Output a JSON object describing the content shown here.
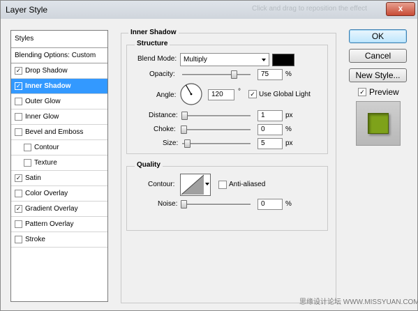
{
  "window": {
    "title": "Layer Style",
    "faded_text": "Click and drag to reposition the effect",
    "close_glyph": "x"
  },
  "styles_panel": {
    "header": "Styles",
    "blending": "Blending Options: Custom",
    "items": [
      {
        "label": "Drop Shadow",
        "checked": true,
        "indent": false,
        "selected": false
      },
      {
        "label": "Inner Shadow",
        "checked": true,
        "indent": false,
        "selected": true
      },
      {
        "label": "Outer Glow",
        "checked": false,
        "indent": false,
        "selected": false
      },
      {
        "label": "Inner Glow",
        "checked": false,
        "indent": false,
        "selected": false
      },
      {
        "label": "Bevel and Emboss",
        "checked": false,
        "indent": false,
        "selected": false
      },
      {
        "label": "Contour",
        "checked": false,
        "indent": true,
        "selected": false
      },
      {
        "label": "Texture",
        "checked": false,
        "indent": true,
        "selected": false
      },
      {
        "label": "Satin",
        "checked": true,
        "indent": false,
        "selected": false
      },
      {
        "label": "Color Overlay",
        "checked": false,
        "indent": false,
        "selected": false
      },
      {
        "label": "Gradient Overlay",
        "checked": true,
        "indent": false,
        "selected": false
      },
      {
        "label": "Pattern Overlay",
        "checked": false,
        "indent": false,
        "selected": false
      },
      {
        "label": "Stroke",
        "checked": false,
        "indent": false,
        "selected": false
      }
    ]
  },
  "inner_shadow": {
    "title": "Inner Shadow",
    "structure": {
      "title": "Structure",
      "blend_mode_label": "Blend Mode:",
      "blend_mode_value": "Multiply",
      "blend_color": "#000000",
      "opacity_label": "Opacity:",
      "opacity_value": "75",
      "opacity_unit": "%",
      "opacity_level": 0.75,
      "angle_label": "Angle:",
      "angle_value": "120",
      "angle_unit": "°",
      "global_light_label": "Use Global Light",
      "global_light_checked": true,
      "distance_label": "Distance:",
      "distance_value": "1",
      "distance_unit": "px",
      "choke_label": "Choke:",
      "choke_value": "0",
      "choke_unit": "%",
      "size_label": "Size:",
      "size_value": "5",
      "size_unit": "px"
    },
    "quality": {
      "title": "Quality",
      "contour_label": "Contour:",
      "anti_aliased_label": "Anti-aliased",
      "anti_aliased_checked": false,
      "noise_label": "Noise:",
      "noise_value": "0",
      "noise_unit": "%"
    }
  },
  "buttons": {
    "ok": "OK",
    "cancel": "Cancel",
    "new_style": "New Style...",
    "preview_label": "Preview",
    "preview_checked": true,
    "preview_color": "#7ea21a"
  },
  "watermark": "思缘设计论坛 WWW.MISSYUAN.COM"
}
